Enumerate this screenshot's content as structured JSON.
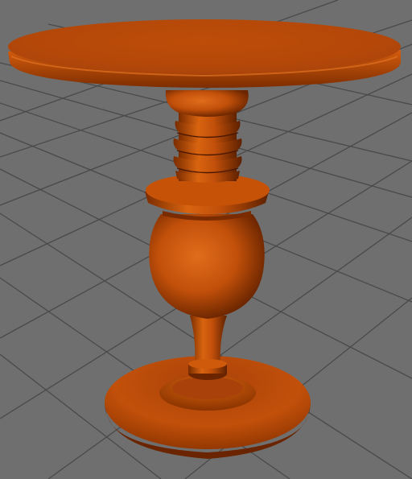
{
  "viewport": {
    "background_color": "#6f6f6f",
    "grid_color": "#4a4a4a",
    "model_color": "#c2500a",
    "model_shadow_color": "#5a1f00",
    "model_highlight_color": "#f08a3a"
  },
  "scene": {
    "model_name": "turned-pedestal-table",
    "parts": [
      "tabletop",
      "top-knob",
      "ring-stack",
      "collar",
      "vase-bulb",
      "stem",
      "stem-ring",
      "base-plinth"
    ]
  }
}
